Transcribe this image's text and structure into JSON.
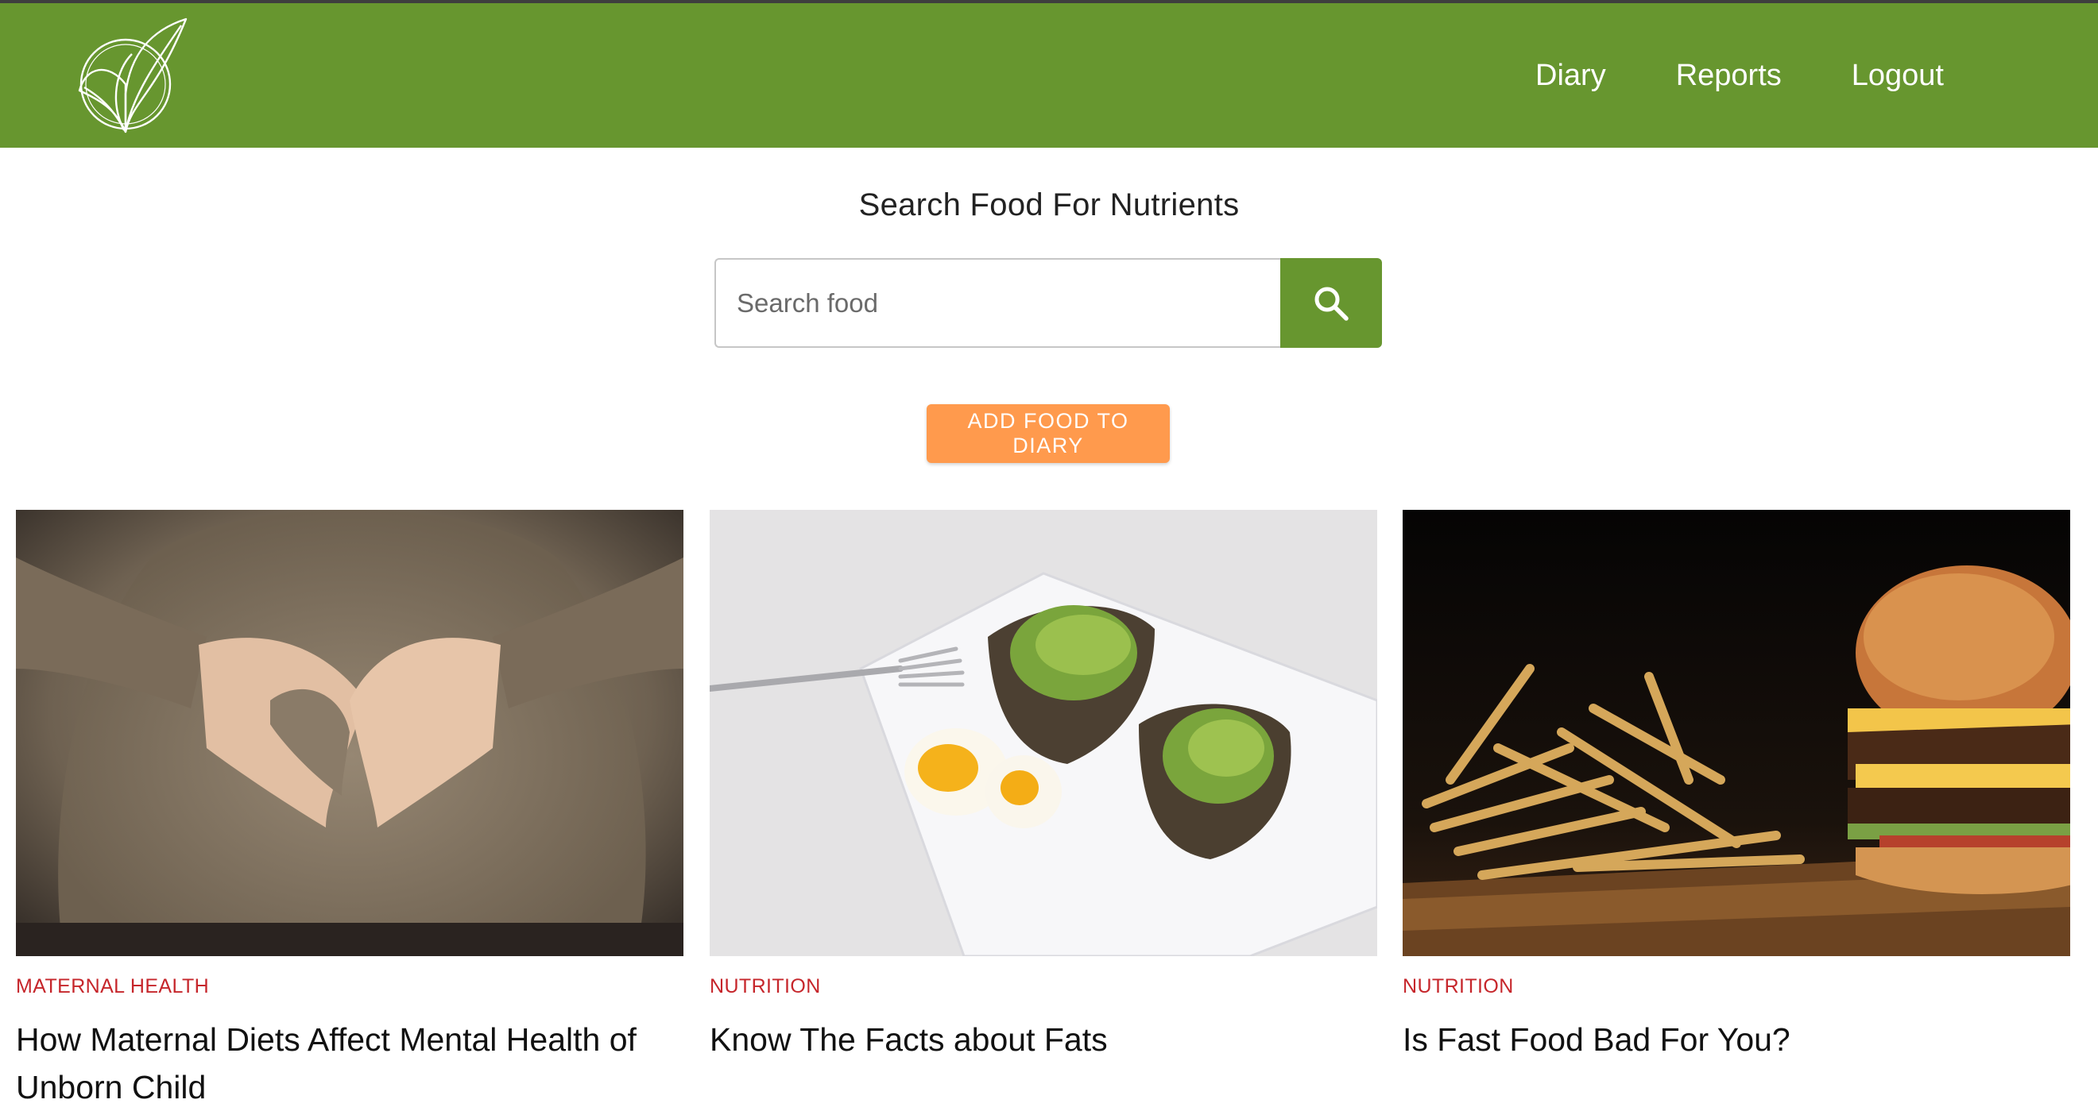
{
  "nav": {
    "items": [
      "Diary",
      "Reports",
      "Logout"
    ]
  },
  "search": {
    "heading": "Search Food For Nutrients",
    "placeholder": "Search food",
    "button_icon": "search-icon"
  },
  "add_button": {
    "label": "ADD FOOD TO DIARY"
  },
  "articles": [
    {
      "category": "MATERNAL HEALTH",
      "title": "How Maternal Diets Affect Mental Health of Unborn Child",
      "image": "pregnant-belly-heart-hands"
    },
    {
      "category": "NUTRITION",
      "title": "Know The Facts about Fats",
      "image": "avocado-toast-egg-plate"
    },
    {
      "category": "NUTRITION",
      "title": "Is Fast Food Bad For You?",
      "image": "burger-and-fries"
    }
  ],
  "colors": {
    "brand_green": "#67962f",
    "accent_orange": "#ff9a4d",
    "category_red": "#c6262b"
  }
}
